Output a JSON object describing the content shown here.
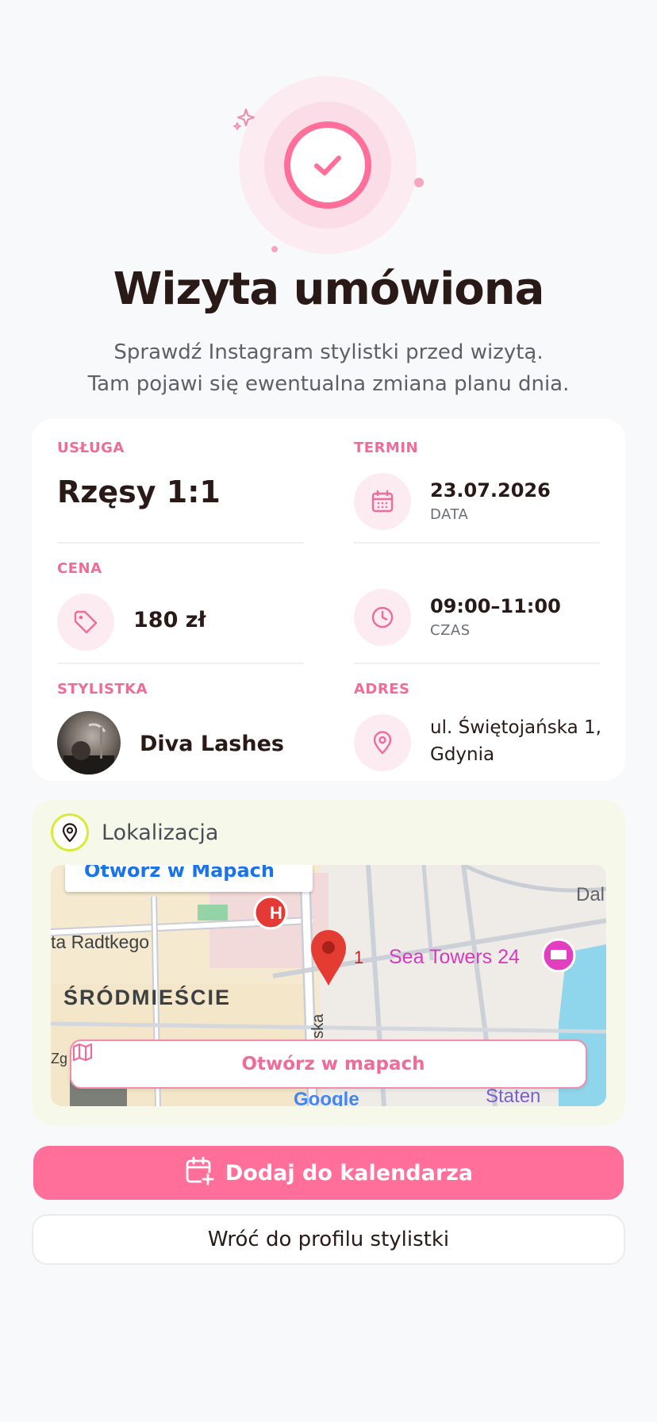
{
  "hero": {
    "title": "Wizyta umówiona",
    "subtitle_line1": "Sprawdź Instagram stylistki przed wizytą.",
    "subtitle_line2": "Tam pojawi się ewentualna zmiana planu dnia.",
    "icons": [
      "check-icon",
      "sparkle-icon"
    ]
  },
  "details": {
    "service": {
      "label": "USŁUGA",
      "value": "Rzęsy 1:1"
    },
    "term": {
      "label": "TERMIN"
    },
    "date": {
      "value": "23.07.2026",
      "sub": "DATA",
      "icon": "calendar-icon"
    },
    "price": {
      "label": "CENA",
      "value": "180 zł",
      "icon": "price-tag-icon"
    },
    "time": {
      "value": "09:00–11:00",
      "sub": "CZAS",
      "icon": "clock-icon"
    },
    "stylist": {
      "label": "STYLISTKA",
      "name": "Diva Lashes"
    },
    "address": {
      "label": "ADRES",
      "line1": "ul. Świętojańska 1,",
      "line2": "Gdynia",
      "icon": "location-pin-icon"
    }
  },
  "location": {
    "title": "Lokalizacja",
    "map": {
      "top_link": "Otwórz w Mapach",
      "labels": {
        "street": "ta Radtkego",
        "district": "ŚRÓDMIEŚCIE",
        "poi": "Sea Towers 24",
        "pin_number": "1",
        "corner_top_right": "Dal",
        "corner_bottom_right": "Staten",
        "street_vertical": "ńska",
        "left_edge": "Zg",
        "google": "Google",
        "hospital": "H"
      }
    },
    "open_maps_label": "Otwórz w mapach"
  },
  "actions": {
    "add_calendar": "Dodaj do kalendarza",
    "back_profile": "Wróć do profilu stylistki"
  },
  "colors": {
    "accent": "#ff6f9a",
    "accent_label": "#ef6c97",
    "background": "#f8f9fb",
    "location_bg": "#f6f9ea"
  }
}
